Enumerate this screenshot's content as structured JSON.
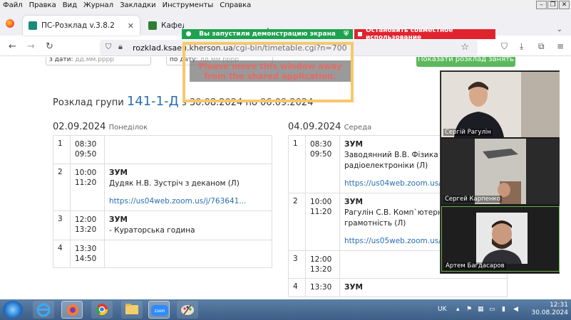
{
  "menu": [
    "Файл",
    "Правка",
    "Вид",
    "Журнал",
    "Закладки",
    "Инструменты",
    "Справка"
  ],
  "tabs": {
    "active": {
      "title": "ПС-Розклад v.3.8.2",
      "close": "✕"
    },
    "inactive": {
      "title": "Кафедра гідротехнічного буд"
    },
    "new_tab": "+"
  },
  "sharing": {
    "green_text": "Вы запустили демонстрацию экрана",
    "red_text": "Остановить совместное использование"
  },
  "address": {
    "host": "rozklad.ksaeu.kherson.ua",
    "path": "/cgi-bin/timetable.cgi?n=700"
  },
  "form": {
    "from_label": "з дати:",
    "to_label": "по дату:",
    "placeholder": "дд.мм.рррр",
    "show_button": "Показати розклад занять"
  },
  "heading": {
    "prefix": "Розклад групи",
    "group": "141-1-Д",
    "range": "з 30.08.2024 по 06.09.2024"
  },
  "days": [
    {
      "date": "02.09.2024",
      "weekday": "Понеділок",
      "rows": [
        {
          "n": "1",
          "start": "08:30",
          "end": "09:50",
          "type": "",
          "desc": "",
          "link": ""
        },
        {
          "n": "2",
          "start": "10:00",
          "end": "11:20",
          "type": "ЗУМ",
          "desc": "Дудяк Н.В. Зустріч з деканом (Л)",
          "link": "https://us04web.zoom.us/j/763641..."
        },
        {
          "n": "3",
          "start": "12:00",
          "end": "13:20",
          "type": "ЗУМ",
          "desc": "- Кураторська година",
          "link": ""
        },
        {
          "n": "4",
          "start": "13:30",
          "end": "14:50",
          "type": "",
          "desc": "",
          "link": ""
        }
      ]
    },
    {
      "date": "04.09.2024",
      "weekday": "Середа",
      "rows": [
        {
          "n": "1",
          "start": "08:30",
          "end": "09:50",
          "type": "ЗУМ",
          "desc": "Заводянний В.В. Фізика з основ радіоелектроніки (Л)",
          "link": "https://us04web.zoom.us/j/61791"
        },
        {
          "n": "2",
          "start": "10:00",
          "end": "11:20",
          "type": "ЗУМ",
          "desc": "Рагулін С.В. Комп`ютерна та ци грамотність (Л)",
          "link": "https://us05web.zoom.us/j/95054"
        },
        {
          "n": "3",
          "start": "12:00",
          "end": "13:20",
          "type": "",
          "desc": "",
          "link": ""
        },
        {
          "n": "4",
          "start": "13:30",
          "end": "",
          "type": "ЗУМ",
          "desc": "",
          "link": ""
        }
      ]
    }
  ],
  "overlay": {
    "message": "Please move this window away from the shared application."
  },
  "participants": [
    "Сергій Рагулін",
    "Сергей Карпенко",
    "Артем Багдасаров"
  ],
  "tray": {
    "lang": "UK",
    "time": "12:31",
    "date": "30.08.2024"
  },
  "colors": {
    "group": "#2a6fb0",
    "link": "#2a6fb0",
    "show_button": "#5cb85c",
    "share_green": "#1ea24f",
    "share_red": "#e0242f",
    "overlay_border": "#f7c86b"
  }
}
